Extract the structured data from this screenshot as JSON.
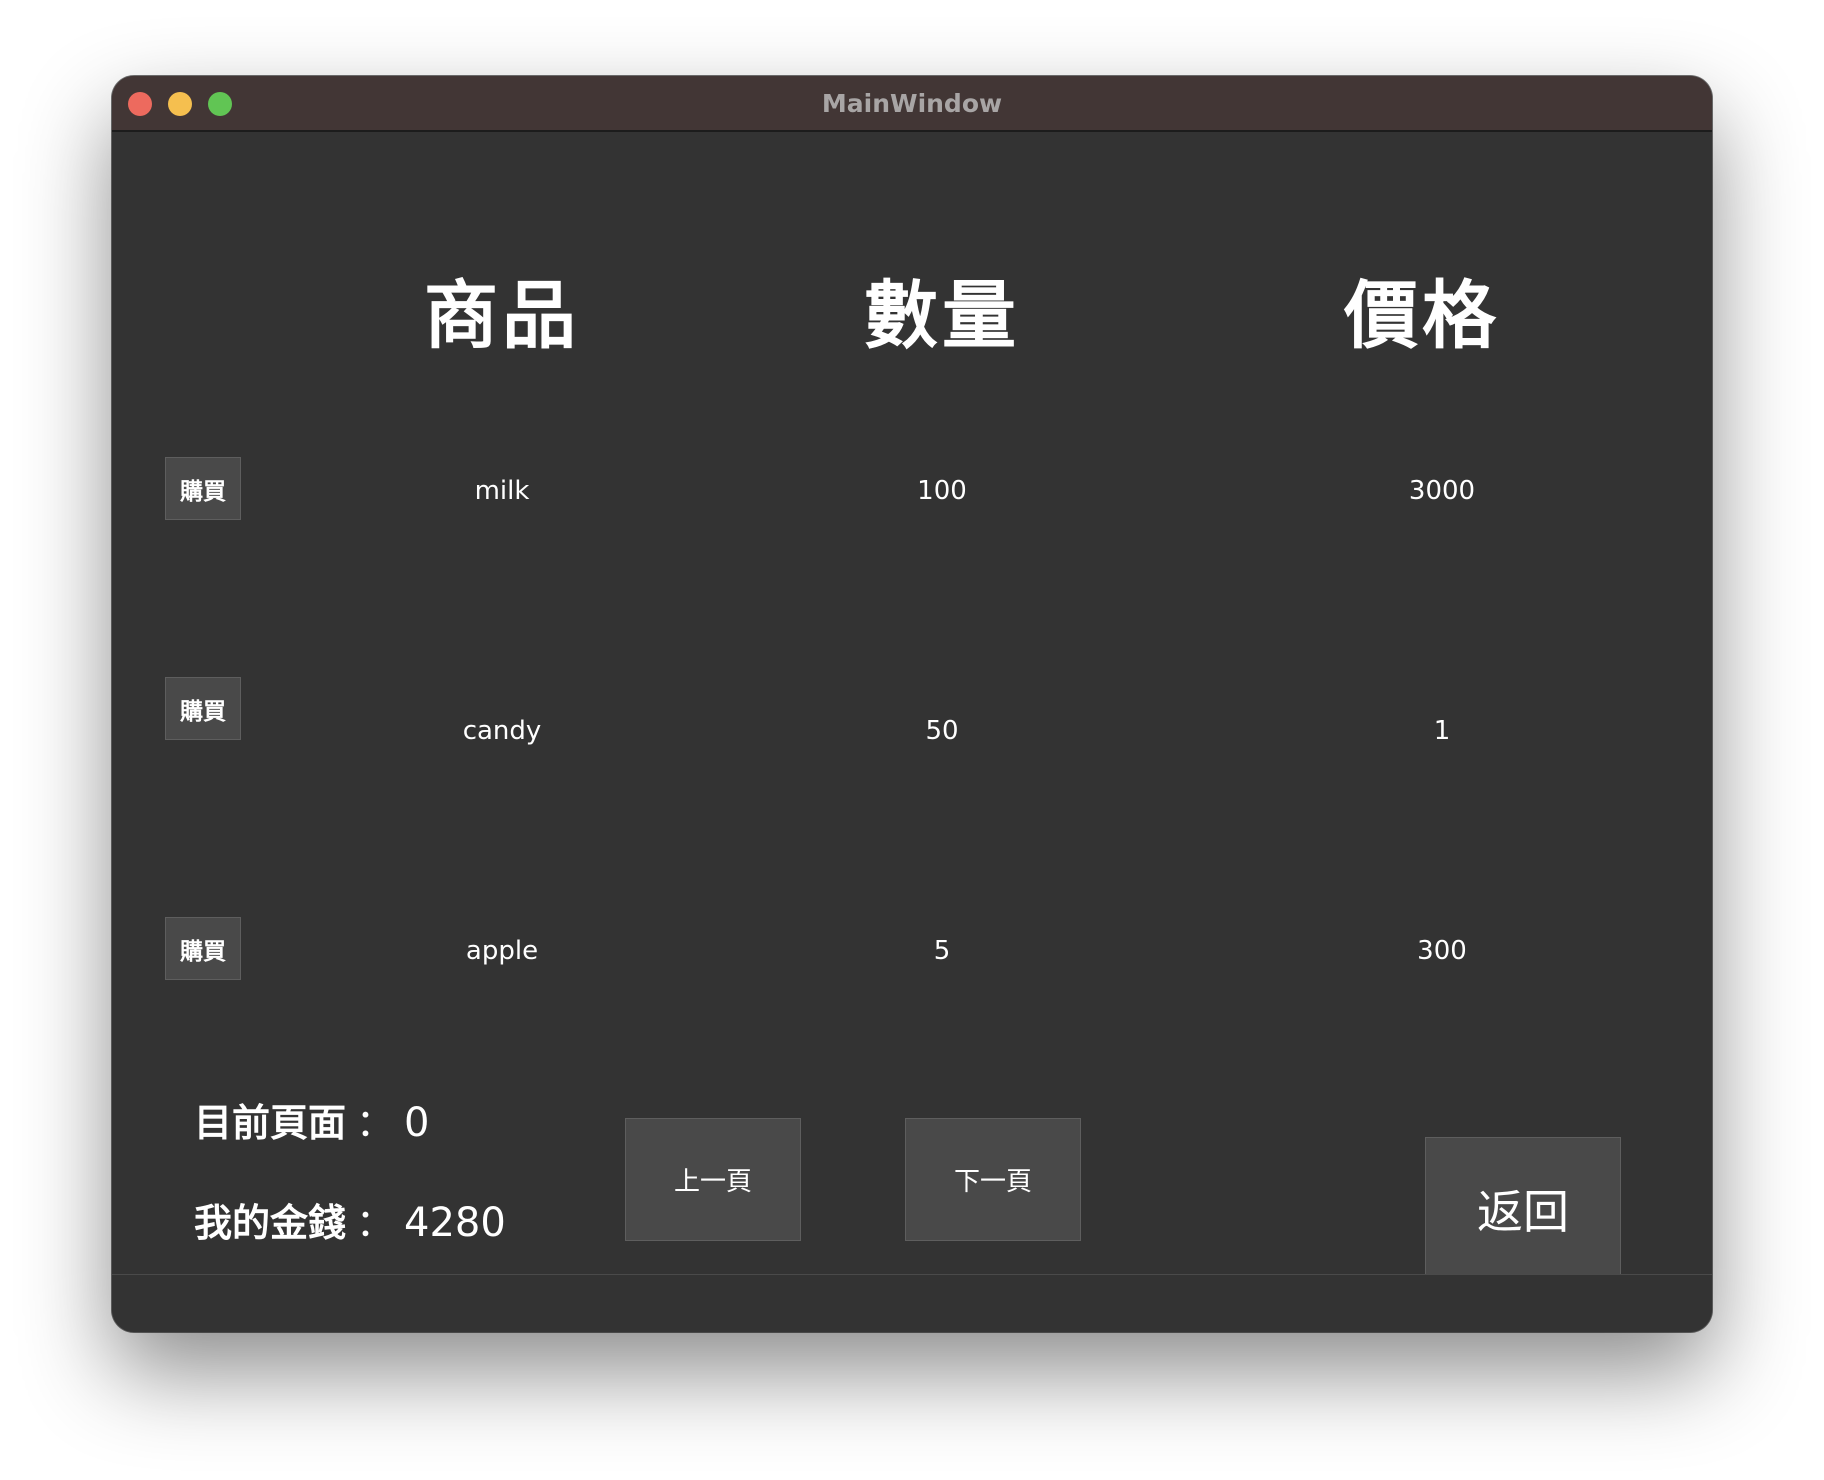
{
  "window": {
    "title": "MainWindow"
  },
  "headers": {
    "product": "商品",
    "quantity": "數量",
    "price": "價格"
  },
  "rows": [
    {
      "buy_label": "購買",
      "name": "milk",
      "quantity": "100",
      "price": "3000"
    },
    {
      "buy_label": "購買",
      "name": "candy",
      "quantity": "50",
      "price": "1"
    },
    {
      "buy_label": "購買",
      "name": "apple",
      "quantity": "5",
      "price": "300"
    }
  ],
  "footer": {
    "current_page_label": "目前頁面",
    "current_page_value": "0",
    "money_label": "我的金錢",
    "money_value": "4280",
    "separator": "：",
    "prev_button": "上一頁",
    "next_button": "下一頁",
    "back_button": "返回"
  },
  "colors": {
    "window_bg": "#333333",
    "titlebar_bg": "#423635",
    "button_bg": "#494949",
    "close": "#ed6a5e",
    "minimize": "#f5bf4f",
    "maximize": "#61c554"
  }
}
